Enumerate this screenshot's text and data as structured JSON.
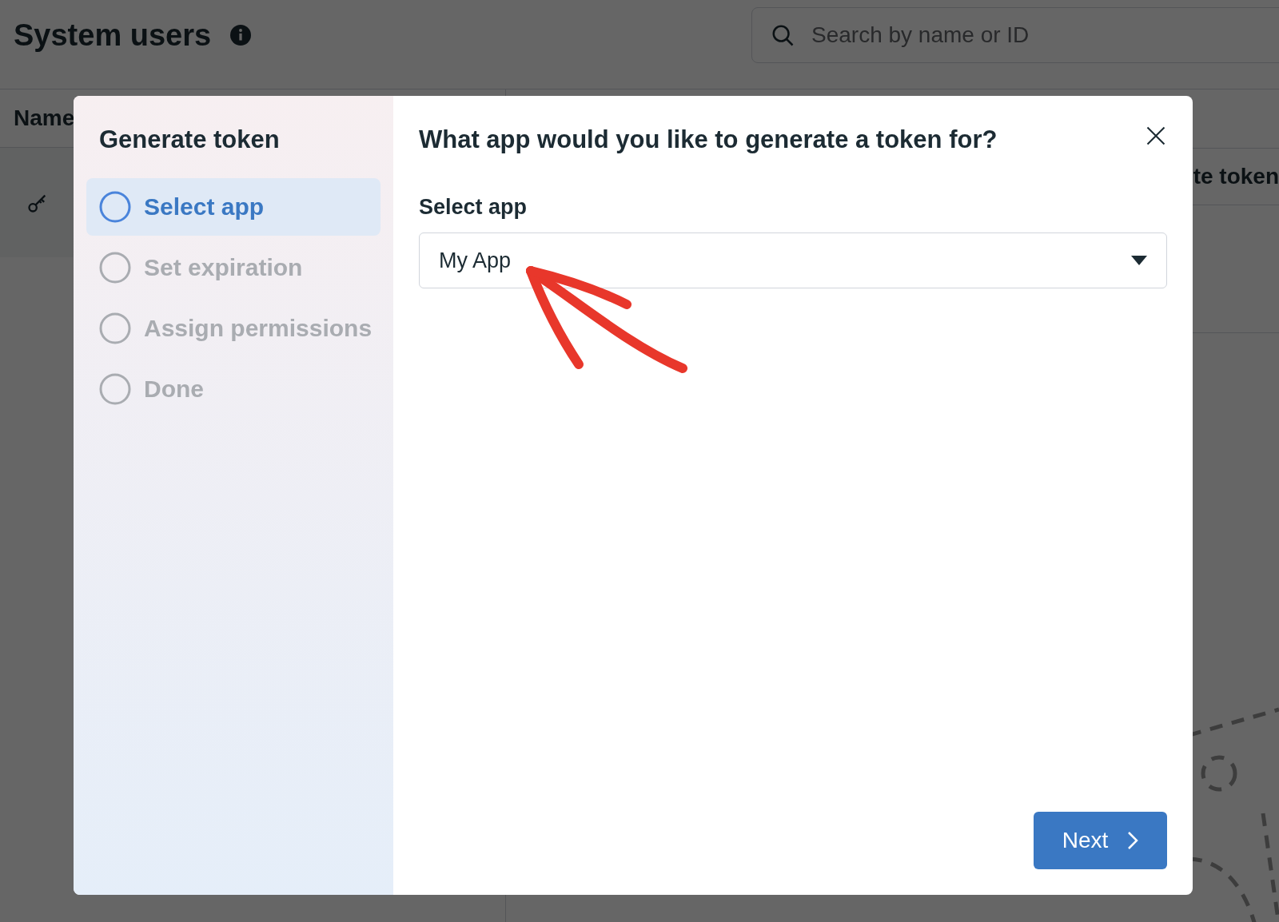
{
  "page": {
    "title": "System users",
    "search": {
      "placeholder": "Search by name or ID"
    },
    "table": {
      "column_1": "Name",
      "row_action": "te token"
    }
  },
  "dialog": {
    "title": "Generate token",
    "steps": [
      {
        "label": "Select app",
        "selected": true
      },
      {
        "label": "Set expiration",
        "selected": false
      },
      {
        "label": "Assign permissions",
        "selected": false
      },
      {
        "label": "Done",
        "selected": false
      }
    ],
    "heading": "What app would you like to generate a token for?",
    "field": {
      "label": "Select app",
      "value": "My App"
    },
    "next_button": "Next"
  }
}
